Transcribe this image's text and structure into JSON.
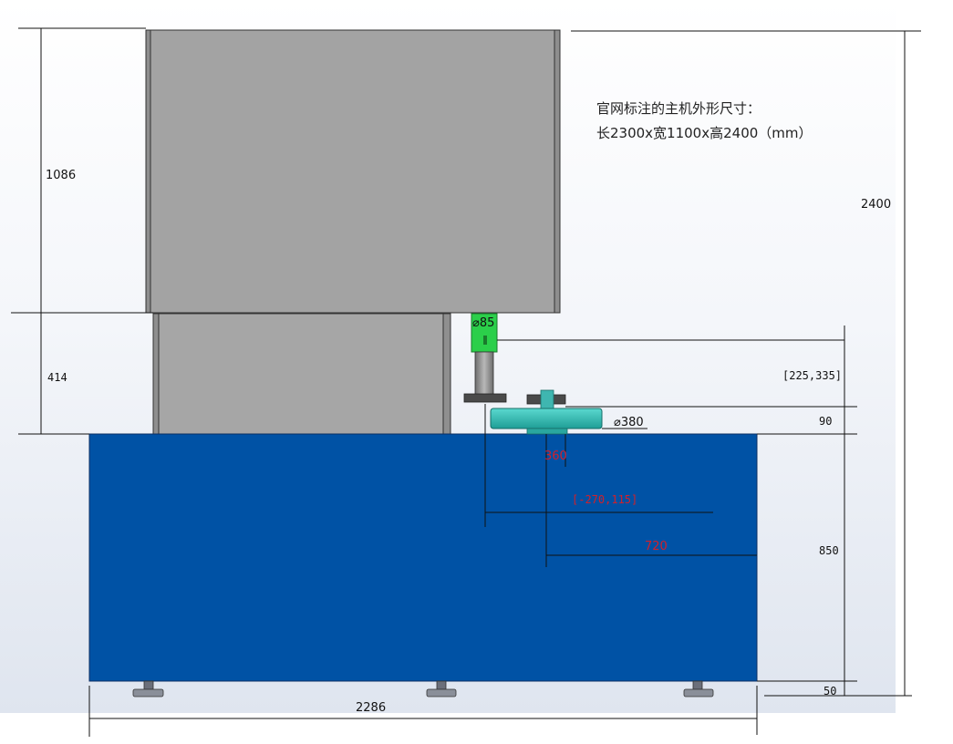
{
  "note": {
    "line1": "官网标注的主机外形尺寸：",
    "line2": "长2300x宽1100x高2400（mm）"
  },
  "dimensions": {
    "upper_height": "1086",
    "middle_height": "414",
    "total_height": "2400",
    "offset_coord": "[225,335]",
    "disc_band": "90",
    "base_height": "850",
    "foot_height": "50",
    "base_width": "2286",
    "shaft_diameter": "⌀85",
    "disc_diameter": "⌀380",
    "hub_width": "360",
    "red_coord": "[-270,115]",
    "center_offset": "720"
  },
  "colors": {
    "upper_cabinet": "#a3a3a3",
    "middle_cabinet": "#a6a6a6",
    "base_body": "#0052a5",
    "shaft_green": "#2bcf4a",
    "disc_teal": "#33c1b8",
    "dimension_red": "#d2202a"
  }
}
